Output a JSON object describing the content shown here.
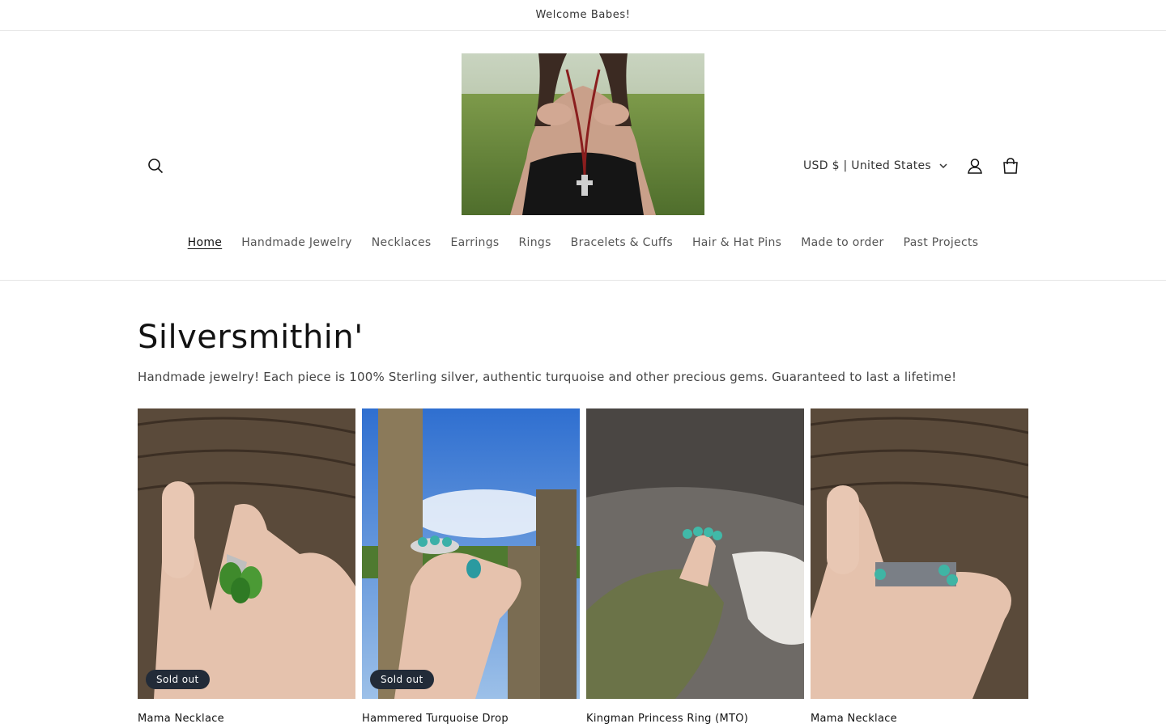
{
  "announcement": {
    "text": "Welcome Babes!"
  },
  "header": {
    "currency_label": "USD $ | United States",
    "icons": {
      "search": "search-icon",
      "account": "account-icon",
      "cart": "cart-icon",
      "dropdown": "chevron-down-icon"
    }
  },
  "nav": {
    "items": [
      {
        "label": "Home"
      },
      {
        "label": "Handmade Jewelry"
      },
      {
        "label": "Necklaces"
      },
      {
        "label": "Earrings"
      },
      {
        "label": "Rings"
      },
      {
        "label": "Bracelets & Cuffs"
      },
      {
        "label": "Hair & Hat Pins"
      },
      {
        "label": "Made to order"
      },
      {
        "label": "Past Projects"
      }
    ]
  },
  "collection": {
    "title": "Silversmithin'",
    "description": "Handmade jewelry! Each piece is 100% Sterling silver, authentic turquoise and other precious gems. Guaranteed to last a lifetime!"
  },
  "products": [
    {
      "name": "Mama Necklace",
      "badge": "Sold out"
    },
    {
      "name": "Hammered Turquoise Drop",
      "badge": "Sold out"
    },
    {
      "name": "Kingman Princess Ring (MTO)"
    },
    {
      "name": "Mama Necklace"
    }
  ],
  "colors": {
    "badge_bg": "#222b38",
    "text": "#121212",
    "border": "#e6e6e6"
  }
}
